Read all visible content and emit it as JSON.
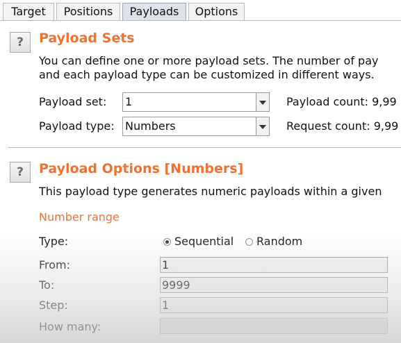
{
  "tabs": [
    {
      "label": "Target"
    },
    {
      "label": "Positions"
    },
    {
      "label": "Payloads",
      "active": true
    },
    {
      "label": "Options"
    }
  ],
  "payload_sets": {
    "help_glyph": "?",
    "title": "Payload Sets",
    "desc_line1": "You can define one or more payload sets. The number of pay",
    "desc_line2": "and each payload type can be customized in different ways.",
    "set_label": "Payload set:",
    "set_value": "1",
    "type_label": "Payload type:",
    "type_value": "Numbers",
    "payload_count": "Payload count: 9,99",
    "request_count": "Request count: 9,99"
  },
  "payload_options": {
    "help_glyph": "?",
    "title": "Payload Options [Numbers]",
    "desc": "This payload type generates numeric payloads within a given",
    "number_range_heading": "Number range",
    "type_label": "Type:",
    "sequential_label": "Sequential",
    "sequential_selected": true,
    "random_label": "Random",
    "from_label": "From:",
    "from_value": "1",
    "to_label": "To:",
    "to_value": "9999",
    "step_label": "Step:",
    "step_value": "1",
    "how_many_label": "How many:",
    "how_many_value": ""
  }
}
